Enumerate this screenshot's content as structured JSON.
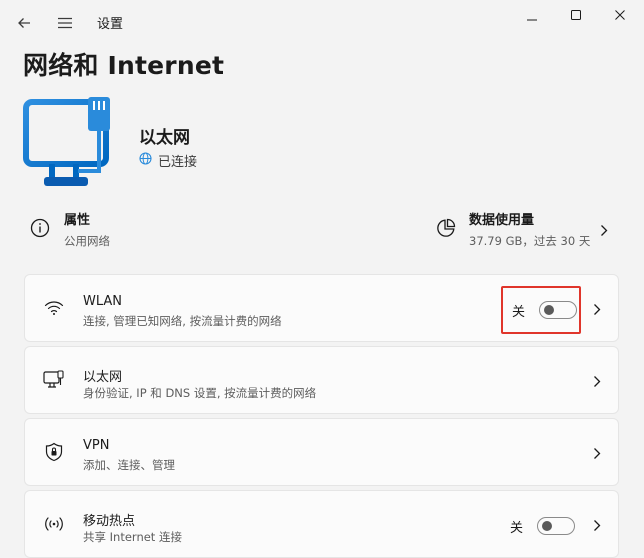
{
  "app": {
    "title": "设置"
  },
  "page": {
    "title": "网络和 Internet"
  },
  "connection": {
    "name": "以太网",
    "status": "已连接"
  },
  "properties": {
    "title": "属性",
    "subtitle": "公用网络"
  },
  "data_usage": {
    "title": "数据使用量",
    "subtitle": "37.79 GB，过去 30 天"
  },
  "items": [
    {
      "title": "WLAN",
      "subtitle": "连接, 管理已知网络, 按流量计费的网络",
      "toggle_label": "关",
      "toggle_on": false,
      "icon": "wifi-icon"
    },
    {
      "title": "以太网",
      "subtitle": "身份验证, IP 和 DNS 设置, 按流量计费的网络",
      "icon": "ethernet-icon"
    },
    {
      "title": "VPN",
      "subtitle": "添加、连接、管理",
      "icon": "vpn-shield-icon"
    },
    {
      "title": "移动热点",
      "subtitle": "共享 Internet 连接",
      "toggle_label": "关",
      "toggle_on": false,
      "icon": "hotspot-icon"
    }
  ],
  "colors": {
    "accent": "#0067c0",
    "highlight": "#e0352b",
    "background": "#f3f3f3",
    "card": "#fbfbfb"
  }
}
